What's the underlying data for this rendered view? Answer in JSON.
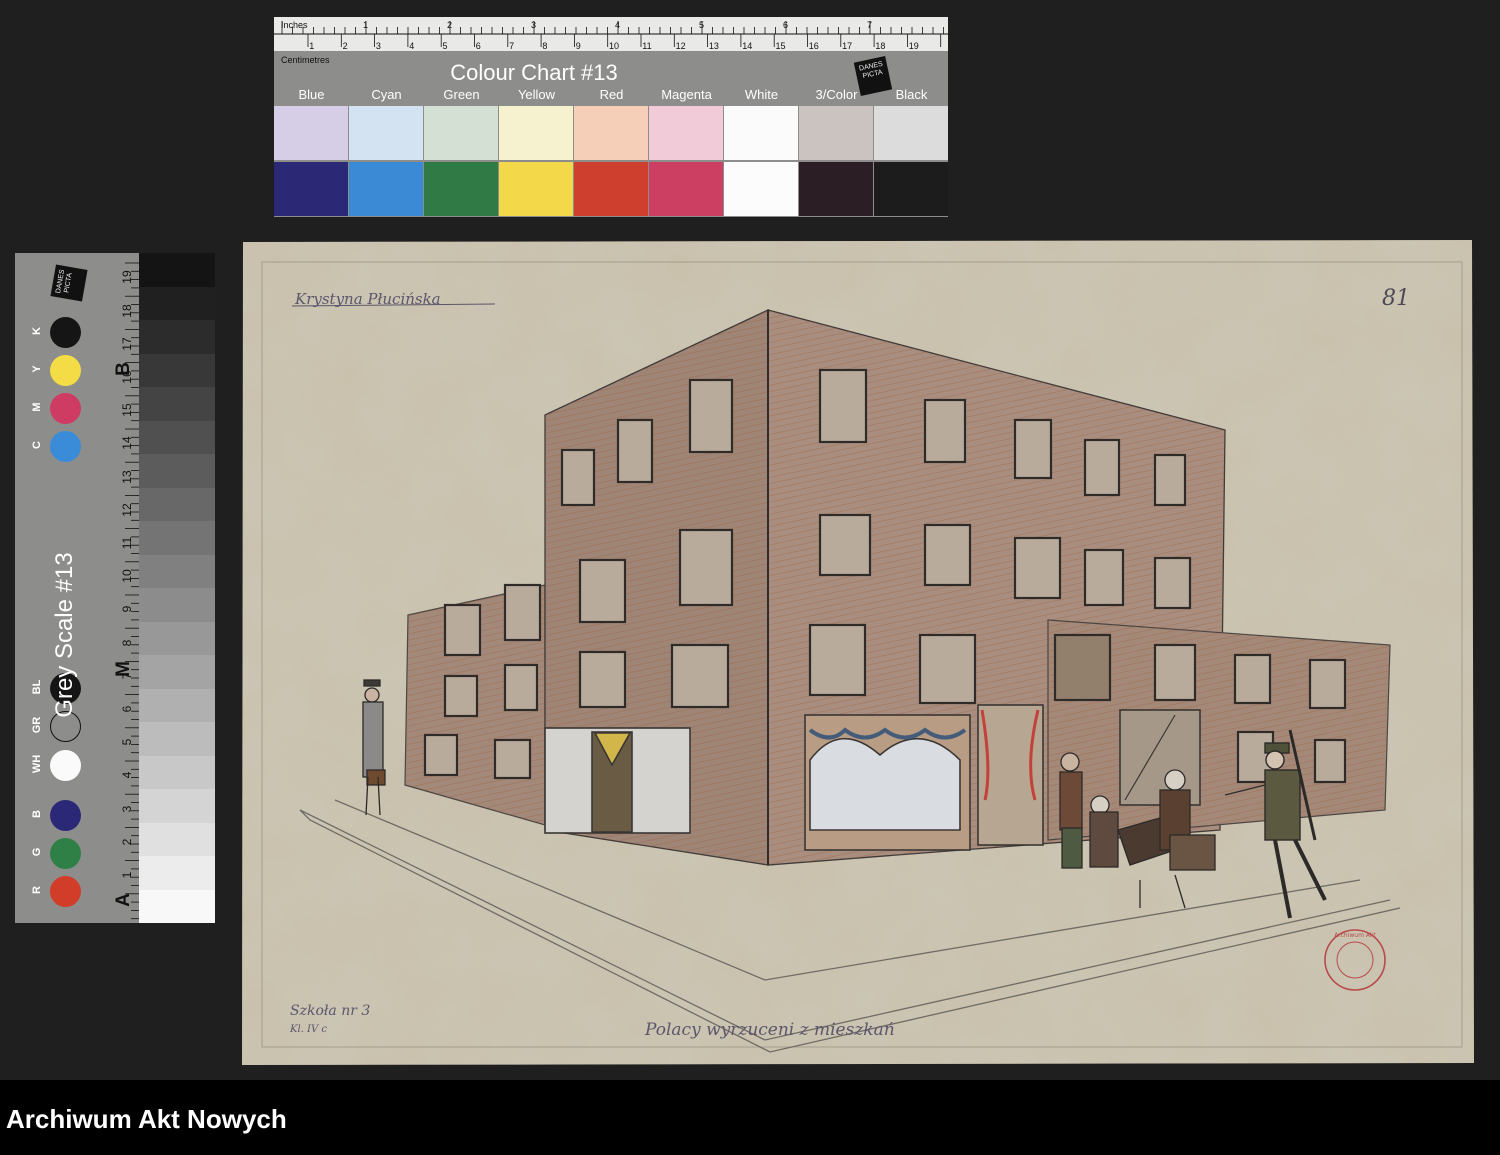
{
  "colour_chart": {
    "title": "Colour Chart #13",
    "ruler_inches_label": "Inches",
    "ruler_cm_label": "Centimetres",
    "logo": "DANES PICTA",
    "labels": [
      "Blue",
      "Cyan",
      "Green",
      "Yellow",
      "Red",
      "Magenta",
      "White",
      "3/Color",
      "Black"
    ],
    "light_colors": [
      "#d6cde6",
      "#d4e3f1",
      "#d3e0d3",
      "#f6f2cf",
      "#f5cfb8",
      "#f2cbd8",
      "#fbfbfb",
      "#cbc3c0",
      "#dcdcdc"
    ],
    "dark_colors": [
      "#2b2876",
      "#3a8ad6",
      "#2f7a45",
      "#f3d84a",
      "#cf3f2d",
      "#cc3f63",
      "#fcfcfc",
      "#2b1f25",
      "#1c1c1c"
    ]
  },
  "grey_scale": {
    "title": "Grey Scale #13",
    "logo": "DANES PICTA",
    "letters": [
      "A",
      "M",
      "B"
    ],
    "dots": [
      {
        "label": "K",
        "color": "#151515"
      },
      {
        "label": "Y",
        "color": "#f3dc45"
      },
      {
        "label": "M",
        "color": "#cf3c63"
      },
      {
        "label": "C",
        "color": "#3b8cd8"
      },
      {
        "label": "BL",
        "color": "#151515"
      },
      {
        "label": "GR",
        "color": "#8d8d8b"
      },
      {
        "label": "WH",
        "color": "#fafafa"
      },
      {
        "label": "B",
        "color": "#2b2878"
      },
      {
        "label": "G",
        "color": "#2e8046"
      },
      {
        "label": "R",
        "color": "#d23d2a"
      }
    ]
  },
  "drawing": {
    "signature": "Krystyna Płucińska",
    "page_number": "81",
    "school_line1": "Szkoła nr 3",
    "school_line2": "Kl. IV c",
    "caption": "Polacy wyrzuceni z mieszkań",
    "stamp": "Archiwum Akt"
  },
  "footer": {
    "text": "Archiwum Akt Nowych"
  }
}
